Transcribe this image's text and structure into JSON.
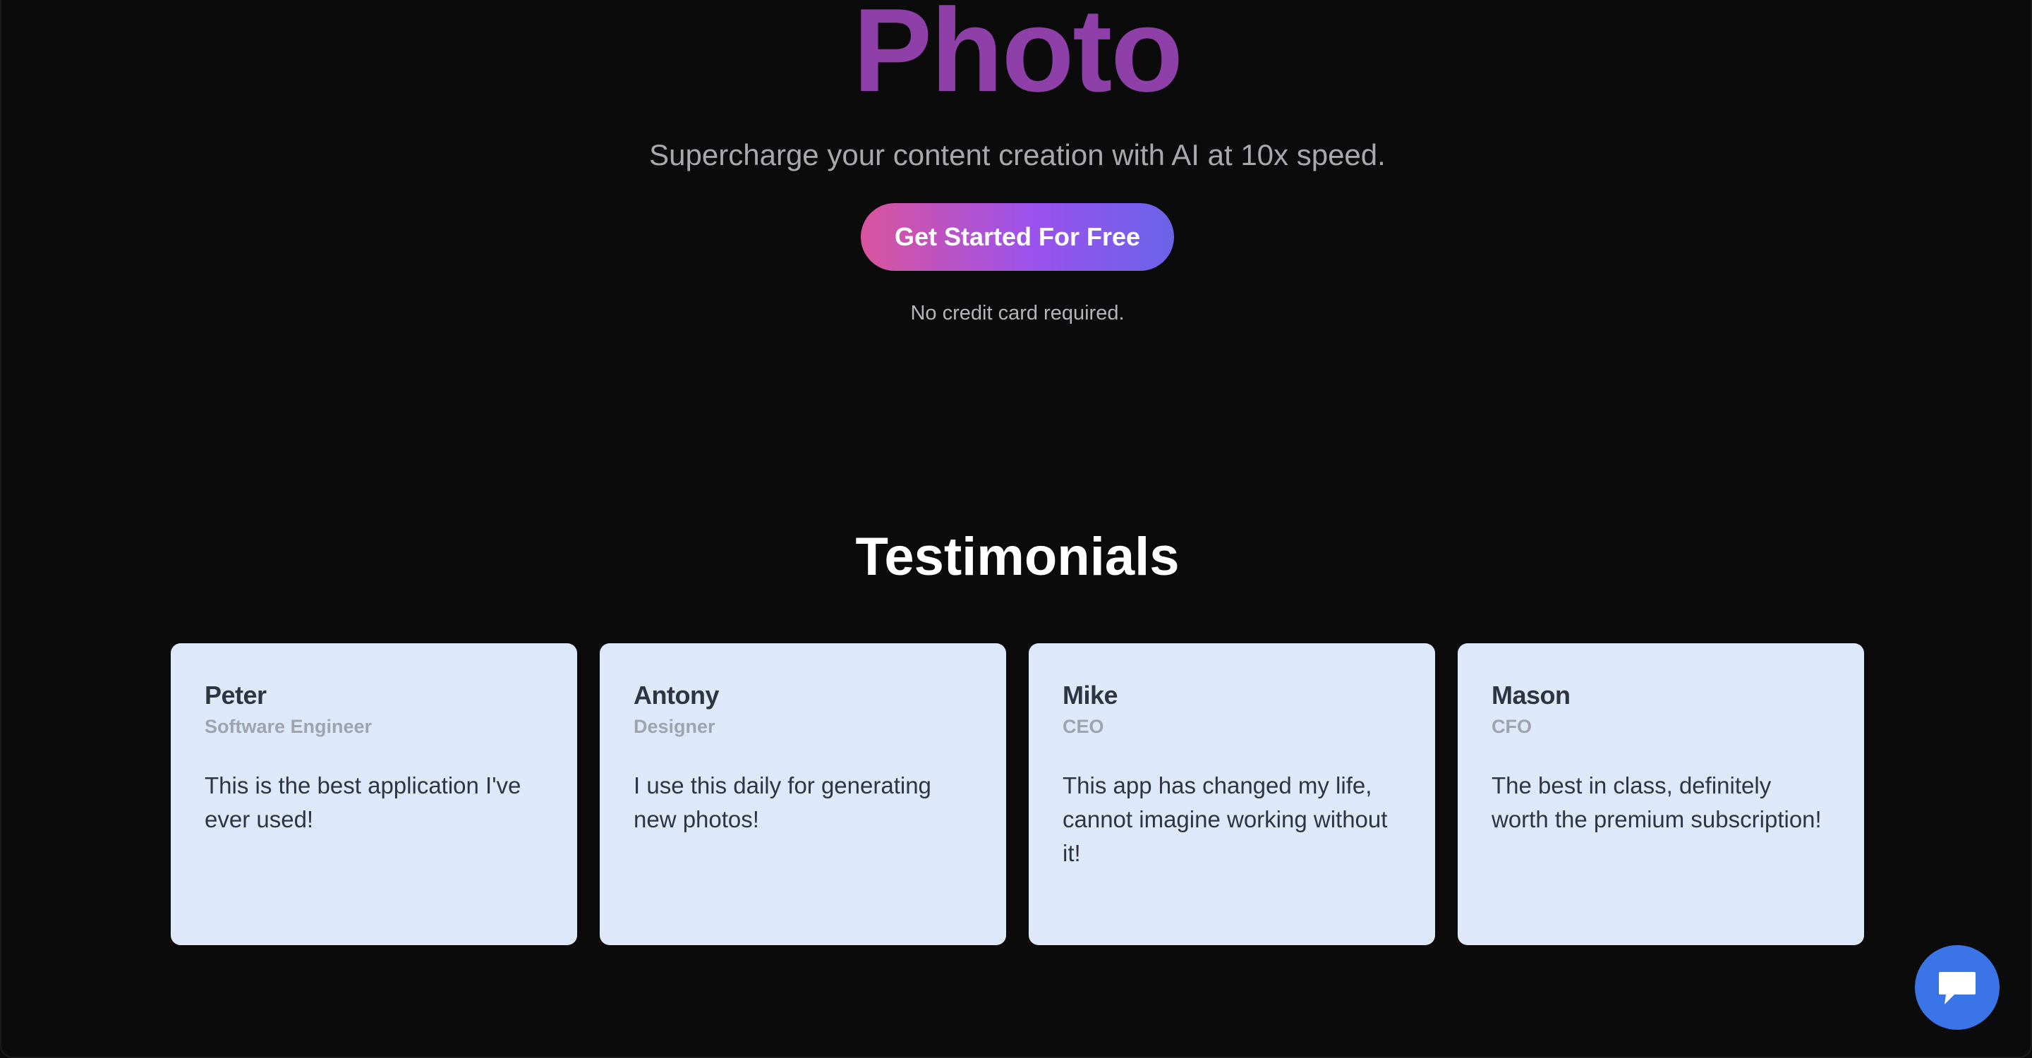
{
  "hero": {
    "title": "Photo",
    "subtitle": "Supercharge your content creation with AI at 10x speed.",
    "cta_label": "Get Started For Free",
    "cta_note": "No credit card required."
  },
  "testimonials": {
    "title": "Testimonials",
    "items": [
      {
        "name": "Peter",
        "role": "Software Engineer",
        "quote": "This is the best application I've ever used!"
      },
      {
        "name": "Antony",
        "role": "Designer",
        "quote": "I use this daily for generating new photos!"
      },
      {
        "name": "Mike",
        "role": "CEO",
        "quote": "This app has changed my life, cannot imagine working without it!"
      },
      {
        "name": "Mason",
        "role": "CFO",
        "quote": "The best in class, definitely worth the premium subscription!"
      }
    ]
  },
  "chat_widget": {
    "icon": "chat-bubble-icon"
  },
  "colors": {
    "background": "#0c0b0b",
    "title_purple": "#8e3fa8",
    "card_background": "#dee8fb",
    "chat_blue": "#3b74e6"
  }
}
